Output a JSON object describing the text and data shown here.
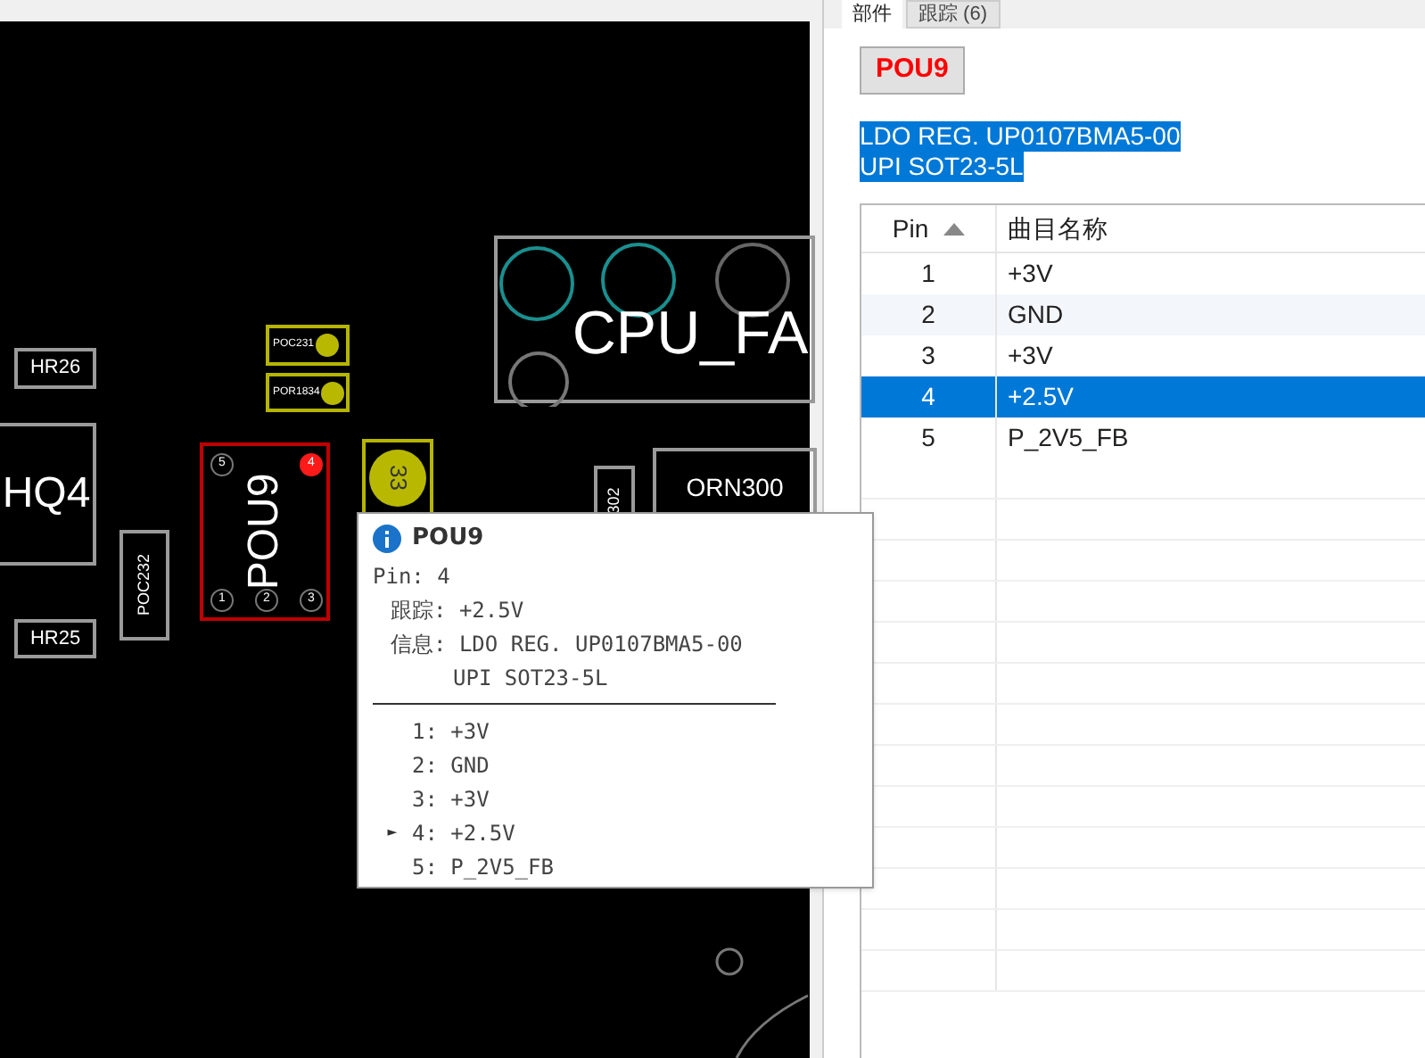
{
  "pcb": {
    "components": [
      {
        "kind": "plain",
        "label": "HR26"
      },
      {
        "kind": "yellow",
        "label": "POC231"
      },
      {
        "kind": "yellow",
        "label": "POR1834"
      },
      {
        "kind": "connector",
        "label": "CPU_FA"
      },
      {
        "kind": "big",
        "label": "HQ4"
      },
      {
        "kind": "selected",
        "label": "POU9",
        "pins": [
          {
            "label": "5",
            "highlighted": false
          },
          {
            "label": "4",
            "highlighted": true
          },
          {
            "label": "1",
            "highlighted": false
          },
          {
            "label": "2",
            "highlighted": false
          },
          {
            "label": "3",
            "highlighted": false
          }
        ]
      },
      {
        "kind": "yellowbig",
        "label": "33"
      },
      {
        "kind": "vertical",
        "label": "302"
      },
      {
        "kind": "array",
        "label": "ORN300"
      },
      {
        "kind": "vertical",
        "label": "POC232"
      },
      {
        "kind": "plain",
        "label": "HR25"
      }
    ]
  },
  "tooltip": {
    "title": "POU9",
    "pin_line": "Pin: 4",
    "trace_line": "跟踪: +2.5V",
    "info_line": "信息: LDO REG. UP0107BMA5-00",
    "info_line_2": "UPI SOT23-5L",
    "pins": [
      {
        "label": "1: +3V",
        "selected": false
      },
      {
        "label": "2: GND",
        "selected": false
      },
      {
        "label": "3: +3V",
        "selected": false
      },
      {
        "label": "4: +2.5V",
        "selected": true
      },
      {
        "label": "5: P_2V5_FB",
        "selected": false
      }
    ],
    "marker": "►"
  },
  "panel": {
    "tabs": [
      {
        "label": "部件",
        "selected": true
      },
      {
        "label": "跟踪 (6)",
        "selected": false
      }
    ],
    "part_button": "POU9",
    "description": [
      "LDO REG. UP0107BMA5-00",
      "UPI SOT23-5L"
    ],
    "table": {
      "columns": [
        "Pin",
        "曲目名称"
      ],
      "rows": [
        {
          "pin": "1",
          "name": "+3V",
          "selected": false
        },
        {
          "pin": "2",
          "name": "GND",
          "selected": false
        },
        {
          "pin": "3",
          "name": "+3V",
          "selected": false
        },
        {
          "pin": "4",
          "name": "+2.5V",
          "selected": true
        },
        {
          "pin": "5",
          "name": "P_2V5_FB",
          "selected": false
        }
      ]
    }
  }
}
